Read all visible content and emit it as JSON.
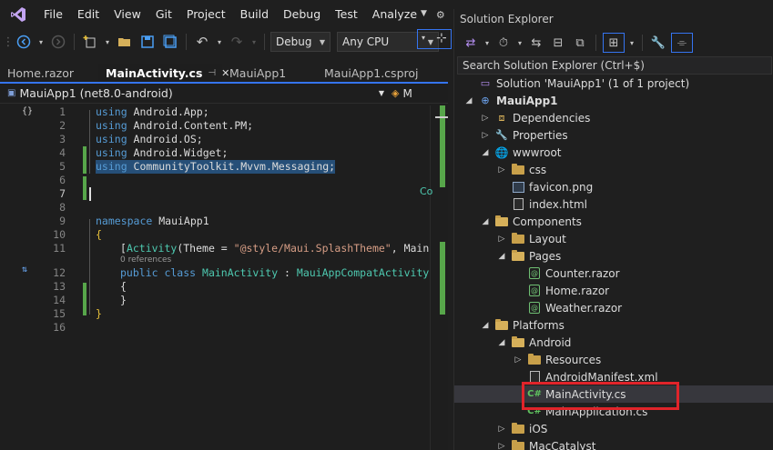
{
  "menu": {
    "items": [
      "File",
      "Edit",
      "View",
      "Git",
      "Project",
      "Build",
      "Debug",
      "Test",
      "Analyze"
    ]
  },
  "toolbar": {
    "configuration": "Debug",
    "platform": "Any CPU"
  },
  "editor": {
    "tabs": [
      {
        "label": "Home.razor",
        "active": false
      },
      {
        "label": "MainActivity.cs",
        "active": true
      },
      {
        "label": "MauiApp1",
        "active": false
      },
      {
        "label": "MauiApp1.csproj",
        "active": false
      }
    ],
    "project_dropdown": "MauiApp1 (net8.0-android)",
    "member_dropdown": "M",
    "codelens_text": "0 references",
    "side_hint": "Co",
    "lines": [
      {
        "n": "1",
        "text": "using Android.App;"
      },
      {
        "n": "2",
        "text": "using Android.Content.PM;"
      },
      {
        "n": "3",
        "text": "using Android.OS;"
      },
      {
        "n": "4",
        "text": "using Android.Widget;"
      },
      {
        "n": "5",
        "text": "using CommunityToolkit.Mvvm.Messaging;"
      },
      {
        "n": "6",
        "text": ""
      },
      {
        "n": "7",
        "text": ""
      },
      {
        "n": "8",
        "text": ""
      },
      {
        "n": "9",
        "text": "namespace MauiApp1"
      },
      {
        "n": "10",
        "text": "{"
      },
      {
        "n": "11",
        "text": "[Activity(Theme = \"@style/Maui.SplashTheme\", Main"
      },
      {
        "n": "12",
        "text": "public class MainActivity : MauiAppCompatActivity"
      },
      {
        "n": "13",
        "text": "{"
      },
      {
        "n": "14",
        "text": "}"
      },
      {
        "n": "15",
        "text": "}"
      },
      {
        "n": "16",
        "text": ""
      }
    ]
  },
  "solution_explorer": {
    "title": "Solution Explorer",
    "search_placeholder": "Search Solution Explorer (Ctrl+$)",
    "tree": [
      {
        "label": "Solution 'MauiApp1' (1 of 1 project)",
        "depth": 0,
        "arrow": "",
        "icon": "solution"
      },
      {
        "label": "MauiApp1",
        "depth": 0,
        "arrow": "open",
        "icon": "project",
        "bold": true
      },
      {
        "label": "Dependencies",
        "depth": 1,
        "arrow": "closed",
        "icon": "dependencies"
      },
      {
        "label": "Properties",
        "depth": 1,
        "arrow": "closed",
        "icon": "properties"
      },
      {
        "label": "wwwroot",
        "depth": 1,
        "arrow": "open",
        "icon": "globe"
      },
      {
        "label": "css",
        "depth": 2,
        "arrow": "closed",
        "icon": "folder"
      },
      {
        "label": "favicon.png",
        "depth": 2,
        "arrow": "",
        "icon": "image"
      },
      {
        "label": "index.html",
        "depth": 2,
        "arrow": "",
        "icon": "file"
      },
      {
        "label": "Components",
        "depth": 1,
        "arrow": "open",
        "icon": "folder-open"
      },
      {
        "label": "Layout",
        "depth": 2,
        "arrow": "closed",
        "icon": "folder"
      },
      {
        "label": "Pages",
        "depth": 2,
        "arrow": "open",
        "icon": "folder-open"
      },
      {
        "label": "Counter.razor",
        "depth": 3,
        "arrow": "",
        "icon": "razor"
      },
      {
        "label": "Home.razor",
        "depth": 3,
        "arrow": "",
        "icon": "razor"
      },
      {
        "label": "Weather.razor",
        "depth": 3,
        "arrow": "",
        "icon": "razor"
      },
      {
        "label": "Platforms",
        "depth": 1,
        "arrow": "open",
        "icon": "folder-open"
      },
      {
        "label": "Android",
        "depth": 2,
        "arrow": "open",
        "icon": "folder-open"
      },
      {
        "label": "Resources",
        "depth": 3,
        "arrow": "closed",
        "icon": "folder"
      },
      {
        "label": "AndroidManifest.xml",
        "depth": 3,
        "arrow": "",
        "icon": "file"
      },
      {
        "label": "MainActivity.cs",
        "depth": 3,
        "arrow": "",
        "icon": "csharp",
        "selected": true
      },
      {
        "label": "MainApplication.cs",
        "depth": 3,
        "arrow": "",
        "icon": "csharp"
      },
      {
        "label": "iOS",
        "depth": 2,
        "arrow": "closed",
        "icon": "folder"
      },
      {
        "label": "MacCatalyst",
        "depth": 2,
        "arrow": "closed",
        "icon": "folder"
      }
    ]
  }
}
